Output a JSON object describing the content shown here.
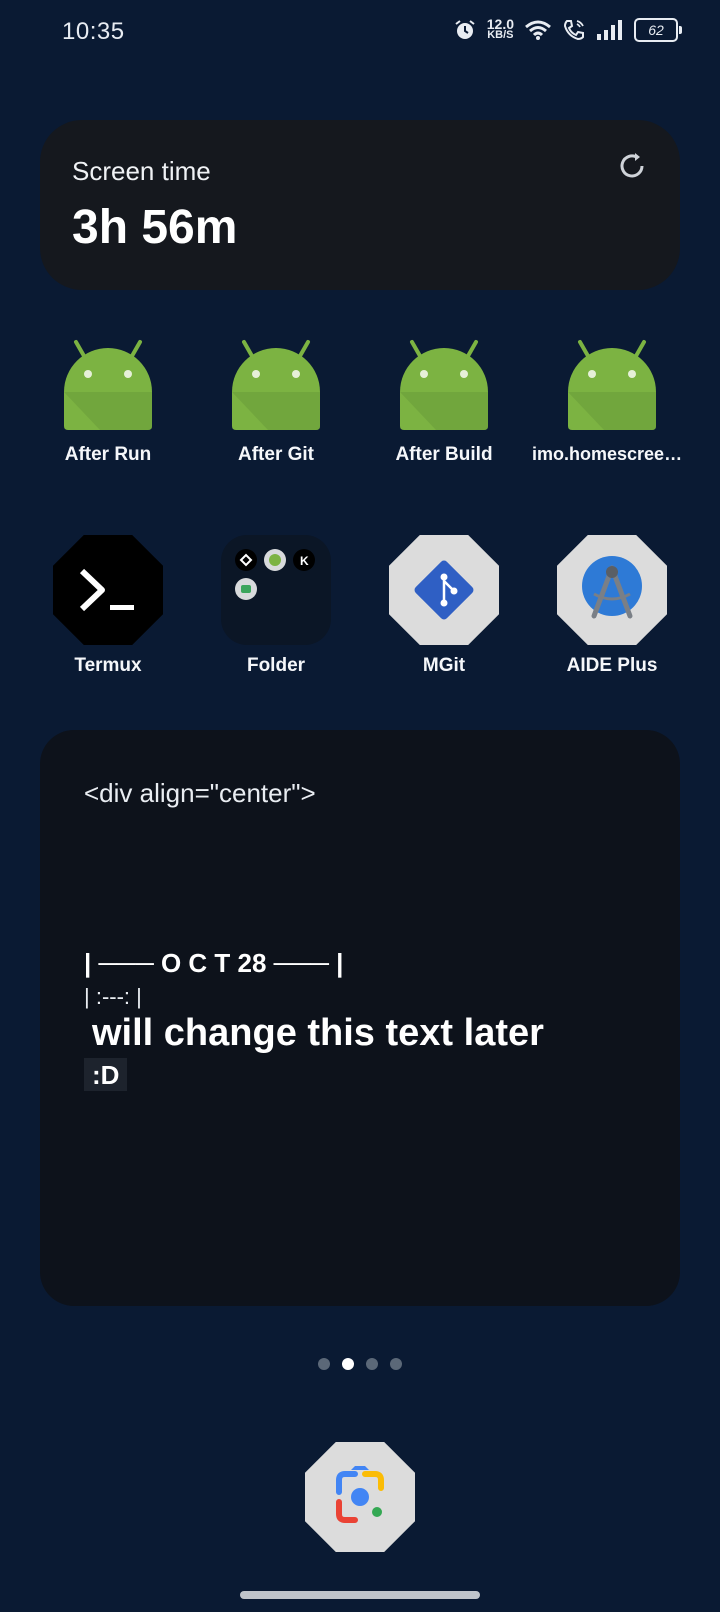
{
  "status_bar": {
    "time": "10:35",
    "net_speed_value": "12.0",
    "net_speed_unit": "KB/S",
    "battery": "62"
  },
  "screen_time_widget": {
    "label": "Screen time",
    "value": "3h 56m"
  },
  "apps_row1": [
    {
      "label": "After Run",
      "icon": "android-icon"
    },
    {
      "label": "After Git",
      "icon": "android-icon"
    },
    {
      "label": "After Build",
      "icon": "android-icon"
    },
    {
      "label": "imo.homescreen_...",
      "icon": "android-icon"
    }
  ],
  "apps_row2": [
    {
      "label": "Termux",
      "icon": "termux-icon"
    },
    {
      "label": "Folder",
      "icon": "folder-icon"
    },
    {
      "label": "MGit",
      "icon": "mgit-icon"
    },
    {
      "label": "AIDE Plus",
      "icon": "aide-plus-icon"
    }
  ],
  "text_widget": {
    "line1": "<div align=\"center\">",
    "line2": "| ─── O C T 28 ─── |",
    "line3": "| :---: |",
    "line4": "will change this text later",
    "line5": ":D"
  },
  "page_indicator": {
    "count": 4,
    "active_index": 1
  },
  "dock": {
    "icon": "google-lens-icon"
  },
  "colors": {
    "background": "#0a1a33",
    "card": "#15181e",
    "android_green": "#7cb342"
  }
}
